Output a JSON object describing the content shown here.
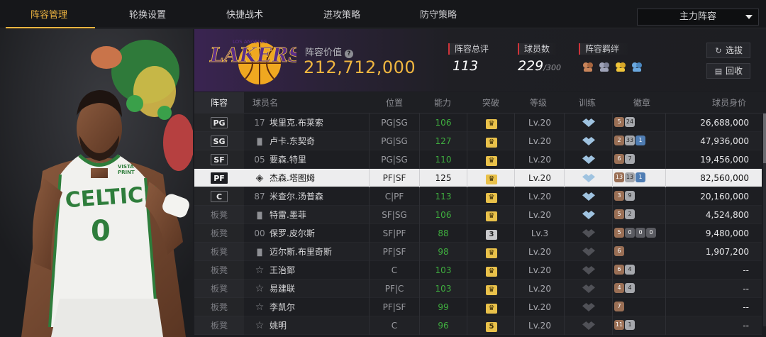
{
  "nav": {
    "tabs": [
      "阵容管理",
      "轮换设置",
      "快捷战术",
      "进攻策略",
      "防守策略"
    ],
    "active_index": 0,
    "lineup_select": "主力阵容"
  },
  "team": {
    "value_label": "阵容价值",
    "value": "212,712,000",
    "rating_label": "阵容总评",
    "rating": "113",
    "players_label": "球员数",
    "players": "229",
    "players_max": "/300",
    "bond_label": "阵容羁绊",
    "bond_icons": [
      "bond-icon-1",
      "bond-icon-2",
      "bond-icon-3",
      "bond-icon-4"
    ],
    "scout_button": "选拔",
    "recycle_button": "回收"
  },
  "table": {
    "headers": {
      "slot": "阵容",
      "name": "球员名",
      "position": "位置",
      "ability": "能力",
      "breakthrough": "突破",
      "level": "等级",
      "training": "训练",
      "badges": "徽章",
      "value": "球员身价"
    },
    "rows": [
      {
        "slot": "PG",
        "starter": true,
        "num": "17",
        "name": "埃里克.布莱索",
        "position": "PG|SG",
        "ability": "106",
        "breakthrough": "crown",
        "level": "Lv.20",
        "train": true,
        "badges": [
          {
            "t": "bronze",
            "v": "5"
          },
          {
            "t": "silver",
            "v": "24"
          }
        ],
        "value": "26,688,000"
      },
      {
        "slot": "SG",
        "starter": true,
        "num": "bars",
        "name": "卢卡.东契奇",
        "position": "PG|SG",
        "ability": "127",
        "breakthrough": "crown",
        "level": "Lv.20",
        "train": true,
        "badges": [
          {
            "t": "bronze",
            "v": "2"
          },
          {
            "t": "silver",
            "v": "33"
          },
          {
            "t": "blue",
            "v": "1"
          }
        ],
        "value": "47,936,000"
      },
      {
        "slot": "SF",
        "starter": true,
        "num": "05",
        "name": "要森.特里",
        "position": "PG|SG",
        "ability": "110",
        "breakthrough": "crown",
        "level": "Lv.20",
        "train": true,
        "badges": [
          {
            "t": "bronze",
            "v": "6"
          },
          {
            "t": "silver",
            "v": "7"
          }
        ],
        "value": "19,456,000"
      },
      {
        "slot": "PF",
        "starter": true,
        "selected": true,
        "num": "diamond",
        "name": "杰森.塔图姆",
        "position": "PF|SF",
        "ability": "125",
        "breakthrough": "crown",
        "level": "Lv.20",
        "train": true,
        "badges": [
          {
            "t": "bronze",
            "v": "13"
          },
          {
            "t": "silver",
            "v": "13"
          },
          {
            "t": "blue",
            "v": "1"
          }
        ],
        "value": "82,560,000"
      },
      {
        "slot": "C",
        "starter": true,
        "num": "87",
        "name": "米查尔.汤普森",
        "position": "C|PF",
        "ability": "113",
        "breakthrough": "crown",
        "level": "Lv.20",
        "train": true,
        "badges": [
          {
            "t": "bronze",
            "v": "3"
          },
          {
            "t": "silver",
            "v": "9"
          }
        ],
        "value": "20,160,000"
      },
      {
        "slot": "板凳",
        "starter": false,
        "num": "bars",
        "name": "特雷.墨菲",
        "position": "SF|SG",
        "ability": "106",
        "breakthrough": "crown",
        "level": "Lv.20",
        "train": true,
        "badges": [
          {
            "t": "bronze",
            "v": "5"
          },
          {
            "t": "silver",
            "v": "2"
          }
        ],
        "value": "4,524,800"
      },
      {
        "slot": "板凳",
        "starter": false,
        "num": "00",
        "name": "保罗.皮尔斯",
        "position": "SF|PF",
        "ability": "88",
        "breakthrough": "3",
        "level": "Lv.3",
        "train": false,
        "badges": [
          {
            "t": "bronze",
            "v": "5"
          },
          {
            "t": "dark",
            "v": "0"
          },
          {
            "t": "dark",
            "v": "0"
          },
          {
            "t": "dark",
            "v": "0"
          }
        ],
        "value": "9,480,000"
      },
      {
        "slot": "板凳",
        "starter": false,
        "num": "bars",
        "name": "迈尔斯.布里奇斯",
        "position": "PF|SF",
        "ability": "98",
        "breakthrough": "crown",
        "level": "Lv.20",
        "train": false,
        "badges": [
          {
            "t": "bronze",
            "v": "6"
          }
        ],
        "value": "1,907,200"
      },
      {
        "slot": "板凳",
        "starter": false,
        "num": "star",
        "name": "王治郅",
        "position": "C",
        "ability": "103",
        "breakthrough": "crown",
        "level": "Lv.20",
        "train": false,
        "badges": [
          {
            "t": "bronze",
            "v": "6"
          },
          {
            "t": "silver",
            "v": "4"
          }
        ],
        "value": "--"
      },
      {
        "slot": "板凳",
        "starter": false,
        "num": "star",
        "name": "易建联",
        "position": "PF|C",
        "ability": "103",
        "breakthrough": "crown",
        "level": "Lv.20",
        "train": false,
        "badges": [
          {
            "t": "bronze",
            "v": "4"
          },
          {
            "t": "silver",
            "v": "4"
          }
        ],
        "value": "--"
      },
      {
        "slot": "板凳",
        "starter": false,
        "num": "star",
        "name": "李凯尔",
        "position": "PF|SF",
        "ability": "99",
        "breakthrough": "crown",
        "level": "Lv.20",
        "train": false,
        "badges": [
          {
            "t": "bronze",
            "v": "7"
          }
        ],
        "value": "--"
      },
      {
        "slot": "板凳",
        "starter": false,
        "num": "star",
        "name": "姚明",
        "position": "C",
        "ability": "96",
        "breakthrough": "5",
        "level": "Lv.20",
        "train": false,
        "badges": [
          {
            "t": "bronze",
            "v": "11"
          },
          {
            "t": "silver",
            "v": "1"
          }
        ],
        "value": "--"
      }
    ]
  },
  "player_art": {
    "team_text": "CELTICS",
    "jersey_number": "0",
    "sponsor": "VISTA PRINT"
  }
}
